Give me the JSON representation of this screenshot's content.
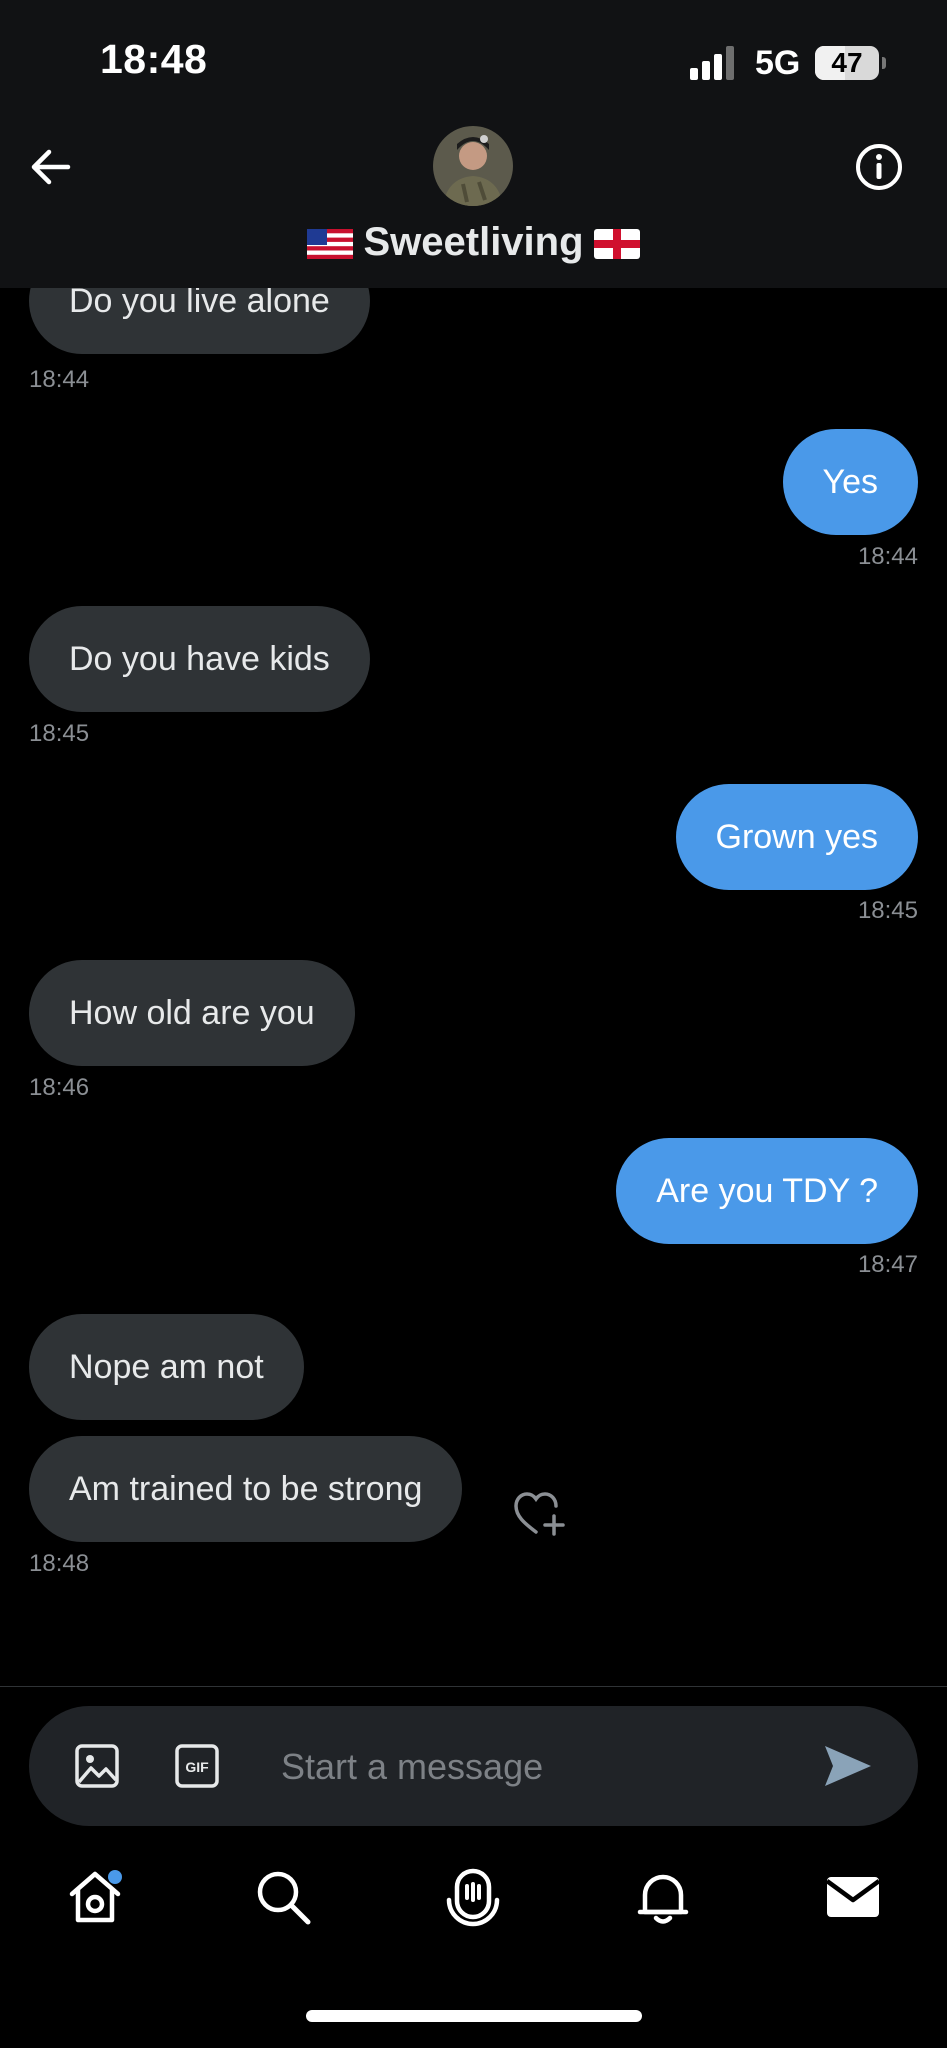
{
  "status_bar": {
    "time": "18:48",
    "network": "5G",
    "battery": "47",
    "battery_level": 0.47
  },
  "header": {
    "contact_name": "Sweetliving",
    "flags": [
      "us-flag-icon",
      "england-flag-icon"
    ]
  },
  "messages": [
    {
      "side": "in",
      "text": "Do you live alone",
      "time": "18:44"
    },
    {
      "side": "out",
      "text": "Yes",
      "time": "18:44"
    },
    {
      "side": "in",
      "text": "Do you have kids",
      "time": "18:45"
    },
    {
      "side": "out",
      "text": "Grown yes",
      "time": "18:45"
    },
    {
      "side": "in",
      "text": "How old are you",
      "time": "18:46"
    },
    {
      "side": "out",
      "text": "Are you TDY ?",
      "time": "18:47"
    },
    {
      "side": "in",
      "text": "Nope am not",
      "time": ""
    },
    {
      "side": "in",
      "text": "Am trained to be strong",
      "time": "18:48"
    }
  ],
  "composer": {
    "placeholder": "Start a message",
    "gif_label": "GIF"
  },
  "nav": {
    "items": [
      "home-icon",
      "search-icon",
      "spaces-icon",
      "notifications-icon",
      "messages-icon"
    ]
  },
  "colors": {
    "outgoing": "#4a99e9",
    "incoming": "#2f3336",
    "background": "#000000"
  }
}
